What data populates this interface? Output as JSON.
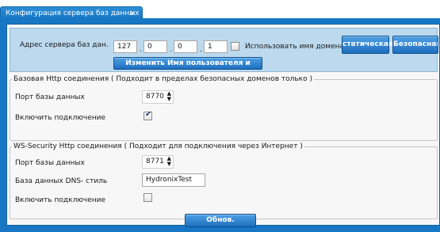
{
  "tab": {
    "title": "Конфигурация сервера баз данных",
    "close": "×"
  },
  "address": {
    "label": "Адрес сервера баз дан.",
    "octets": [
      "127",
      "0",
      "0",
      "1"
    ],
    "dot": ".",
    "use_domain_label": "Использовать имя домена",
    "use_domain_checked": false,
    "static_button": "статическая",
    "secure_button": "Безопасная в",
    "change_credentials_button": "Изменить Имя пользователя и пароль"
  },
  "http": {
    "title": "Базовая Http соединения ( Подходит в пределах безопасных доменов только )",
    "port_label": "Порт базы данных",
    "port_value": "8770",
    "enable_label": "Включить подключение",
    "enabled": true
  },
  "ws": {
    "title": "WS-Security Http соединения ( Подходит для подключения через Интернет )",
    "port_label": "Порт базы данных",
    "port_value": "8771",
    "dns_label": "База данных DNS- стиль",
    "dns_value": "HydronixTest",
    "enable_label": "Включить подключение",
    "enabled": false
  },
  "refresh_button": "Обнов.",
  "spinner": {
    "up": "▲",
    "down": "▼"
  },
  "checkmark": "✔",
  "colors": {
    "accent": "#1777c4",
    "address_bar": "#bcd9ee",
    "button": "#2f86d2"
  }
}
